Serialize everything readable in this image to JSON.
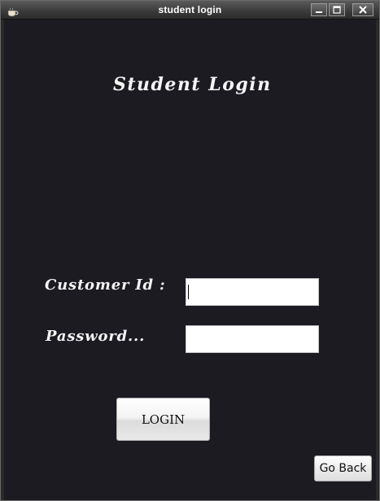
{
  "window": {
    "title": "student login",
    "icons": {
      "app": "coffee-cup-icon",
      "minimize": "minimize-icon",
      "maximize": "maximize-icon",
      "close": "close-icon"
    }
  },
  "form": {
    "heading": "Student Login",
    "customer_id_label": "Customer Id  :",
    "customer_id_value": "",
    "password_label": "Password...",
    "password_value": "",
    "login_label": "LOGIN",
    "goback_label": "Go Back"
  },
  "colors": {
    "background": "#1c1b22",
    "text": "#f4f4f4",
    "field": "#ffffff"
  }
}
